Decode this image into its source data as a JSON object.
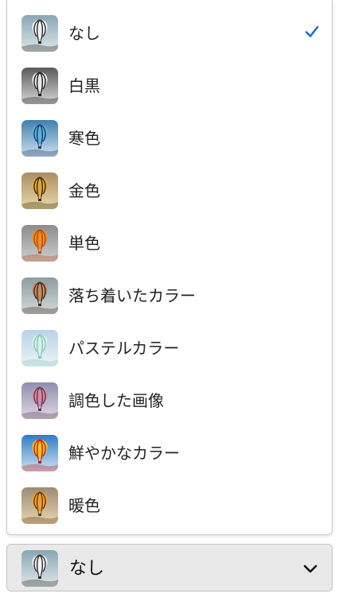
{
  "menu": {
    "items": [
      {
        "label": "なし",
        "selected": true,
        "icon": "balloon-thumbnail-none",
        "sky": [
          "#8aa6b4",
          "#dfe6ea"
        ],
        "balloon": [
          "#f2f2f2",
          "#2b2b2b"
        ]
      },
      {
        "label": "白黒",
        "selected": false,
        "icon": "balloon-thumbnail-monochrome",
        "sky": [
          "#5a5a5a",
          "#d8d8d8"
        ],
        "balloon": [
          "#e8e8e8",
          "#1a1a1a"
        ]
      },
      {
        "label": "寒色",
        "selected": false,
        "icon": "balloon-thumbnail-cool",
        "sky": [
          "#3f7fb0",
          "#cfe0ee"
        ],
        "balloon": [
          "#5fb0d8",
          "#1c3c6a"
        ]
      },
      {
        "label": "金色",
        "selected": false,
        "icon": "balloon-thumbnail-golden",
        "sky": [
          "#a98f63",
          "#ecd8a8"
        ],
        "balloon": [
          "#e0a63a",
          "#3a2a10"
        ]
      },
      {
        "label": "単色",
        "selected": false,
        "icon": "balloon-thumbnail-single-color",
        "sky": [
          "#8c8c8c",
          "#cfcfcf"
        ],
        "balloon": [
          "#f28a22",
          "#b04d10"
        ]
      },
      {
        "label": "落ち着いたカラー",
        "selected": false,
        "icon": "balloon-thumbnail-muted",
        "sky": [
          "#8a9ea2",
          "#d5dad8"
        ],
        "balloon": [
          "#c88a62",
          "#3c2c26"
        ]
      },
      {
        "label": "パステルカラー",
        "selected": false,
        "icon": "balloon-thumbnail-pastel",
        "sky": [
          "#b9d3e6",
          "#eef3f7"
        ],
        "balloon": [
          "#d8f0e8",
          "#86c8b8"
        ]
      },
      {
        "label": "調色した画像",
        "selected": false,
        "icon": "balloon-thumbnail-toned",
        "sky": [
          "#8d8fb0",
          "#e2d8de"
        ],
        "balloon": [
          "#d88ba0",
          "#5a3a5c"
        ]
      },
      {
        "label": "鮮やかなカラー",
        "selected": false,
        "icon": "balloon-thumbnail-vivid",
        "sky": [
          "#2f7dc4",
          "#cfe2f2"
        ],
        "balloon": [
          "#f0c020",
          "#c02020"
        ]
      },
      {
        "label": "暖色",
        "selected": false,
        "icon": "balloon-thumbnail-warm",
        "sky": [
          "#9a8c74",
          "#e8d6b0"
        ],
        "balloon": [
          "#f0a030",
          "#6a3a10"
        ]
      }
    ],
    "check_icon": "checkmark-icon",
    "check_color": "#1a6fd4"
  },
  "select": {
    "value": "なし",
    "icon": "balloon-thumbnail-none",
    "chevron_icon": "chevron-down-icon"
  }
}
